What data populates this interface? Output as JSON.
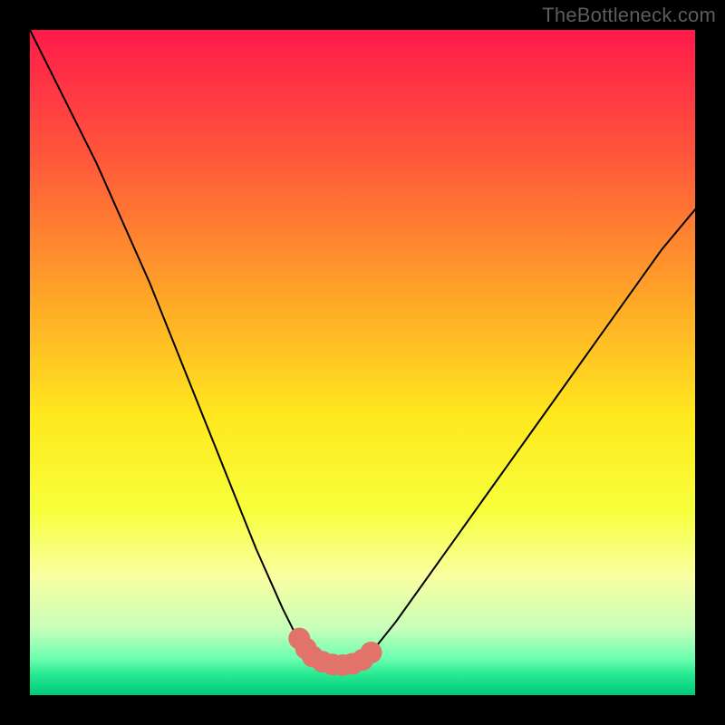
{
  "watermark": "TheBottleneck.com",
  "chart_data": {
    "type": "line",
    "title": "",
    "xlabel": "",
    "ylabel": "",
    "xlim": [
      0,
      100
    ],
    "ylim": [
      0,
      100
    ],
    "grid": false,
    "legend": false,
    "background_gradient": {
      "stops": [
        {
          "offset": 0.0,
          "color": "#ff1a4b"
        },
        {
          "offset": 0.2,
          "color": "#ff5a3a"
        },
        {
          "offset": 0.4,
          "color": "#ffa528"
        },
        {
          "offset": 0.58,
          "color": "#ffe81e"
        },
        {
          "offset": 0.72,
          "color": "#f7ff3a"
        },
        {
          "offset": 0.82,
          "color": "#faffa0"
        },
        {
          "offset": 0.9,
          "color": "#c8ffba"
        },
        {
          "offset": 0.945,
          "color": "#6cffb0"
        },
        {
          "offset": 0.97,
          "color": "#25e892"
        },
        {
          "offset": 1.0,
          "color": "#00c97a"
        }
      ]
    },
    "series": [
      {
        "name": "left-branch",
        "color": "#000000",
        "stroke_width": 2,
        "x": [
          0,
          2,
          4,
          6,
          8,
          10,
          12,
          14,
          16,
          18,
          20,
          22,
          24,
          26,
          28,
          30,
          32,
          34,
          36,
          38,
          40,
          41,
          42,
          43
        ],
        "y": [
          100,
          96,
          92,
          88,
          84,
          80,
          75.5,
          71,
          66.5,
          62,
          57,
          52,
          47,
          42,
          37,
          32,
          27,
          22,
          17.5,
          13,
          9,
          7.5,
          6,
          5
        ]
      },
      {
        "name": "valley-floor",
        "color": "#000000",
        "stroke_width": 2,
        "x": [
          43,
          44,
          45,
          46,
          47,
          48,
          49,
          50,
          51
        ],
        "y": [
          5,
          4.7,
          4.5,
          4.4,
          4.4,
          4.5,
          4.7,
          5.2,
          6
        ]
      },
      {
        "name": "right-branch",
        "color": "#000000",
        "stroke_width": 2,
        "x": [
          51,
          55,
          60,
          65,
          70,
          75,
          80,
          85,
          90,
          95,
          100
        ],
        "y": [
          6,
          11,
          18,
          25,
          32,
          39,
          46,
          53,
          60,
          67,
          73
        ]
      },
      {
        "name": "valley-markers",
        "type": "scatter",
        "color": "#e2736b",
        "marker_radius": 12,
        "x": [
          40.5,
          41.5,
          42.5,
          44,
          45.5,
          47,
          48.5,
          50,
          51.3
        ],
        "y": [
          8.5,
          7,
          5.8,
          5,
          4.6,
          4.5,
          4.7,
          5.3,
          6.4
        ]
      }
    ]
  }
}
